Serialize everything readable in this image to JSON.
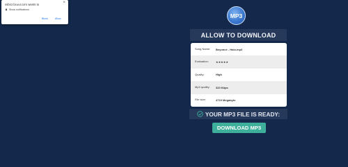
{
  "notification": {
    "title": "ssbnz.bcuui.com wants to",
    "close": "×",
    "message": "Show notifications",
    "block_label": "Block",
    "allow_label": "Allow"
  },
  "logo": {
    "text": "MP3"
  },
  "header": {
    "title": "ALLOW TO DOWNLOAD"
  },
  "info": {
    "rows": [
      {
        "label": "Song Name:",
        "value": "Beyoncé - Halo.mp3"
      },
      {
        "label": "Evaluation:",
        "stars": 5
      },
      {
        "label": "Quality:",
        "value": "High"
      },
      {
        "label": "Mp3 quality:",
        "value": "320 Kbps"
      },
      {
        "label": "File size:",
        "value": "4719 Megabyte"
      }
    ]
  },
  "ready": {
    "text": "YOUR MP3 FILE IS READY:"
  },
  "download": {
    "label": "DOWNLOAD MP3"
  },
  "colors": {
    "background": "#13284a",
    "header_bg": "#26395a",
    "button": "#3daf9b",
    "stars": "#f3b33b"
  }
}
